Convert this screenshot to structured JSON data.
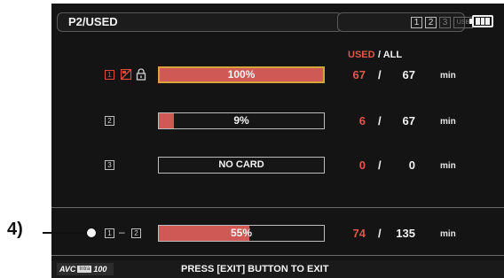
{
  "header": {
    "title": "P2/USED",
    "slots": [
      "1",
      "2",
      "3",
      "USB"
    ]
  },
  "columns": {
    "used": "USED",
    "separator": "/ ALL"
  },
  "rows": [
    {
      "slot_icon": "1",
      "percent_label": "100%",
      "fill_fraction": 1.0,
      "used": "67",
      "slash": "/",
      "all": "67",
      "unit": "min",
      "selected": true,
      "write_protect_icon": "write-protect-icon",
      "lock_icon": "lock-icon"
    },
    {
      "slot_icon": "2",
      "percent_label": "9%",
      "fill_fraction": 0.09,
      "used": "6",
      "slash": "/",
      "all": "67",
      "unit": "min",
      "selected": false
    },
    {
      "slot_icon": "3",
      "percent_label": "NO CARD",
      "fill_fraction": 0.0,
      "used": "0",
      "slash": "/",
      "all": "0",
      "unit": "min",
      "selected": false
    }
  ],
  "total": {
    "from_icon": "1",
    "dash": "–",
    "to_icon": "2",
    "percent_label": "55%",
    "fill_fraction": 0.55,
    "used": "74",
    "slash": "/",
    "all": "135",
    "unit": "min"
  },
  "footer": {
    "codec_text": "AVC",
    "codec_badge": "Intra",
    "codec_num": "100",
    "message": "PRESS [EXIT] BUTTON TO EXIT"
  },
  "callout": {
    "label": "4)"
  },
  "colors": {
    "accent_red": "#e2564a",
    "bar_fill": "#cf5a55",
    "selected_border": "#d6a43a",
    "background": "#141414"
  }
}
